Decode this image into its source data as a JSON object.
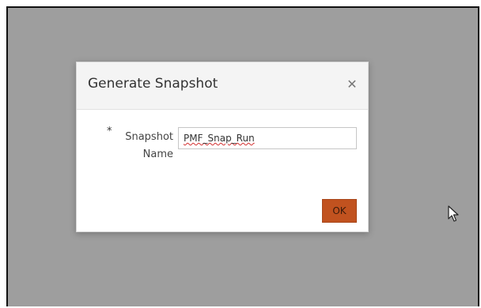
{
  "dialog": {
    "title": "Generate Snapshot",
    "close_icon": "close-icon",
    "required_marker": "*",
    "field_label": "Snapshot Name",
    "field_value": "PMF_Snap_Run",
    "ok_label": "OK"
  },
  "colors": {
    "overlay": "#9e9e9e",
    "ok_button": "#c1521f",
    "header": "#f4f4f4"
  },
  "cursor": "mouse-pointer-icon"
}
